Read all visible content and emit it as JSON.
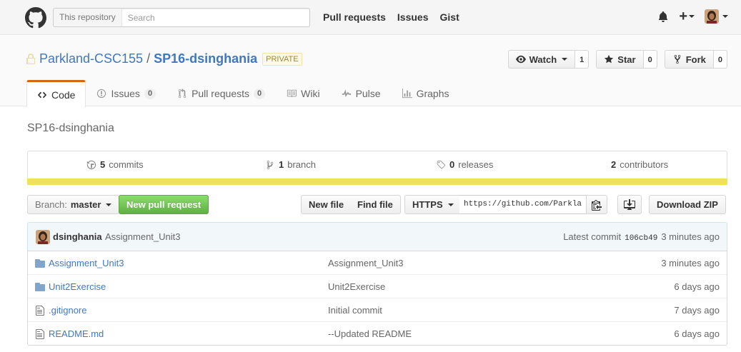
{
  "header": {
    "search_scope": "This repository",
    "search_placeholder": "Search",
    "nav": [
      "Pull requests",
      "Issues",
      "Gist"
    ],
    "plus_label": "+"
  },
  "repo": {
    "owner": "Parkland-CSC155",
    "separator": "/",
    "name": "SP16-dsinghania",
    "private_label": "PRIVATE",
    "watch_label": "Watch",
    "watch_count": "1",
    "star_label": "Star",
    "star_count": "0",
    "fork_label": "Fork",
    "fork_count": "0"
  },
  "tabs": {
    "code": "Code",
    "issues": "Issues",
    "issues_count": "0",
    "pulls": "Pull requests",
    "pulls_count": "0",
    "wiki": "Wiki",
    "pulse": "Pulse",
    "graphs": "Graphs"
  },
  "description": "SP16-dsinghania",
  "summary": {
    "commits_num": "5",
    "commits_label": "commits",
    "branches_num": "1",
    "branches_label": "branch",
    "releases_num": "0",
    "releases_label": "releases",
    "contributors_num": "2",
    "contributors_label": "contributors",
    "language_color": "#f1e05a"
  },
  "file_nav": {
    "branch_label": "Branch:",
    "branch_name": "master",
    "new_pr": "New pull request",
    "new_file": "New file",
    "find_file": "Find file",
    "protocol": "HTTPS",
    "clone_url": "https://github.com/Parkla",
    "download_zip": "Download ZIP"
  },
  "latest_commit": {
    "author": "dsinghania",
    "message": "Assignment_Unit3",
    "label": "Latest commit",
    "sha": "106cb49",
    "age": "3 minutes ago"
  },
  "files": [
    {
      "type": "dir",
      "name": "Assignment_Unit3",
      "message": "Assignment_Unit3",
      "age": "3 minutes ago"
    },
    {
      "type": "dir",
      "name": "Unit2Exercise",
      "message": "Unit2Exercise",
      "age": "6 days ago"
    },
    {
      "type": "file",
      "name": ".gitignore",
      "message": "Initial commit",
      "age": "7 days ago"
    },
    {
      "type": "file",
      "name": "README.md",
      "message": "--Updated README",
      "age": "6 days ago"
    }
  ]
}
